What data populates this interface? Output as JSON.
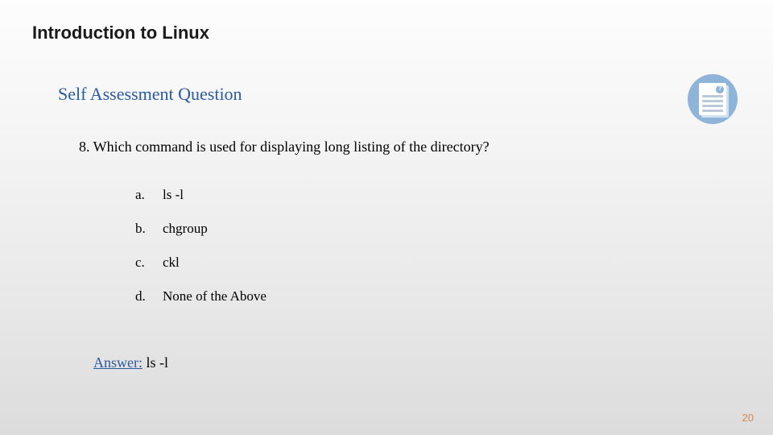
{
  "title": "Introduction to Linux",
  "subtitle": "Self Assessment Question",
  "question": "8. Which command is used for displaying long listing of the directory?",
  "options": [
    {
      "letter": "a.",
      "text": "ls -l"
    },
    {
      "letter": "b.",
      "text": "chgroup"
    },
    {
      "letter": "c.",
      "text": "ckl"
    },
    {
      "letter": "d.",
      "text": "None of the Above"
    }
  ],
  "answer_label": "Answer:",
  "answer_text": " ls -l",
  "page_number": "20",
  "icon_name": "question-document-icon"
}
